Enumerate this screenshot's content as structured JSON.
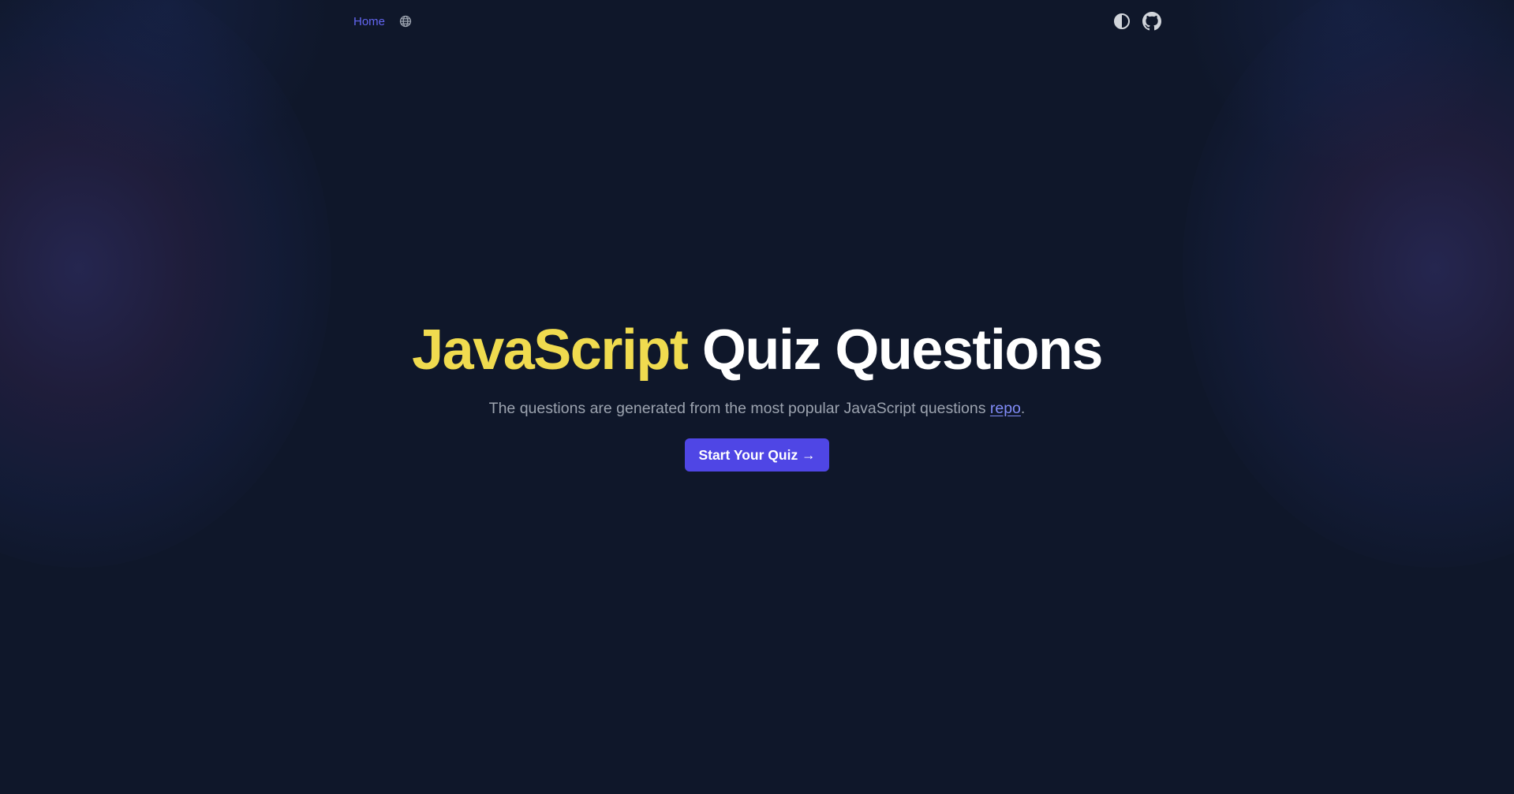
{
  "nav": {
    "home_label": "Home",
    "language_icon": "globe-icon",
    "theme_icon": "contrast-icon",
    "github_icon": "github-icon"
  },
  "hero": {
    "title_accent": "JavaScript",
    "title_rest": "Quiz Questions",
    "subtitle_prefix": "The questions are generated from the most popular JavaScript questions",
    "subtitle_link": "repo",
    "subtitle_suffix": ".",
    "cta_label": "Start Your Quiz →"
  },
  "colors": {
    "background": "#0f172a",
    "accent_yellow": "#f0db4f",
    "link_indigo": "#6366f1",
    "button_indigo": "#4f46e5",
    "subtitle_gray": "#9ca3af"
  }
}
